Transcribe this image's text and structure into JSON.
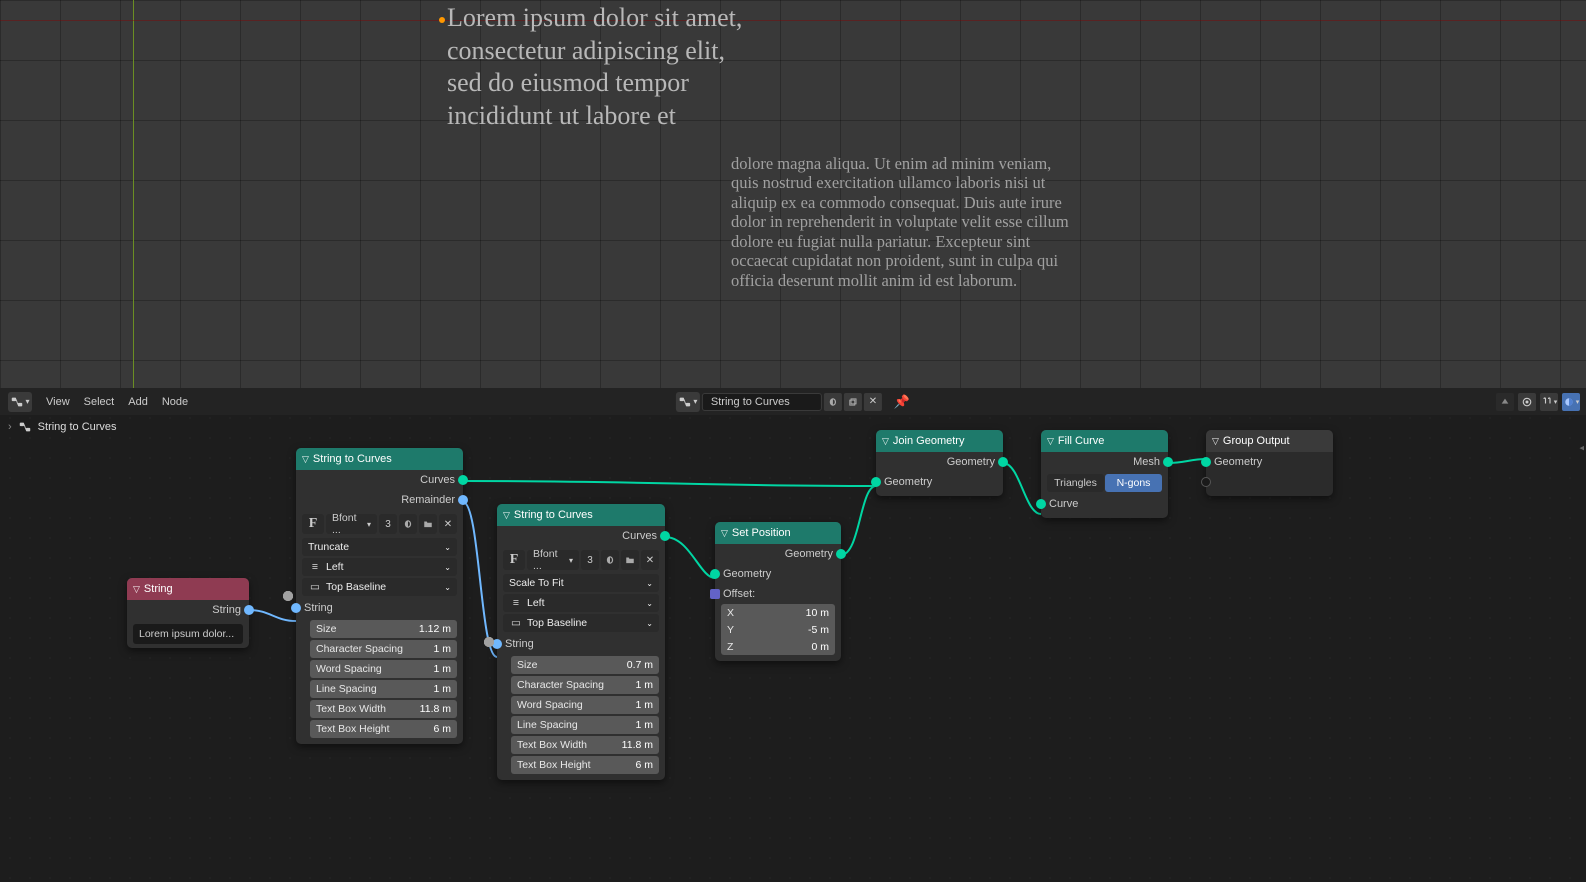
{
  "viewport": {
    "text1": "Lorem ipsum dolor sit amet, consectetur adipiscing elit, sed do eiusmod tempor incididunt ut labore et",
    "text2": "dolore magna aliqua. Ut enim ad minim veniam, quis nostrud exercitation ullamco laboris nisi ut aliquip ex ea commodo consequat. Duis aute irure dolor in reprehenderit in voluptate velit esse cillum dolore eu fugiat nulla pariatur. Excepteur sint occaecat cupidatat non proident, sunt in culpa qui officia deserunt mollit anim id est laborum."
  },
  "toolbar": {
    "menus": [
      "View",
      "Select",
      "Add",
      "Node"
    ],
    "nodegroup_name": "String to Curves",
    "breadcrumb": "String to Curves"
  },
  "nodes": {
    "string": {
      "title": "String",
      "out_label": "String",
      "value": "Lorem ipsum dolor..."
    },
    "stc1": {
      "title": "String to Curves",
      "out_curves": "Curves",
      "out_remainder": "Remainder",
      "in_string": "String",
      "font_name": "Bfont ...",
      "font_users": "3",
      "overflow": "Truncate",
      "align_x": "Left",
      "align_y": "Top Baseline",
      "props": [
        {
          "label": "Size",
          "value": "1.12 m"
        },
        {
          "label": "Character Spacing",
          "value": "1 m"
        },
        {
          "label": "Word Spacing",
          "value": "1 m"
        },
        {
          "label": "Line Spacing",
          "value": "1 m"
        },
        {
          "label": "Text Box Width",
          "value": "11.8 m"
        },
        {
          "label": "Text Box Height",
          "value": "6 m"
        }
      ]
    },
    "stc2": {
      "title": "String to Curves",
      "out_curves": "Curves",
      "in_string": "String",
      "font_name": "Bfont ...",
      "font_users": "3",
      "overflow": "Scale To Fit",
      "align_x": "Left",
      "align_y": "Top Baseline",
      "props": [
        {
          "label": "Size",
          "value": "0.7 m"
        },
        {
          "label": "Character Spacing",
          "value": "1 m"
        },
        {
          "label": "Word Spacing",
          "value": "1 m"
        },
        {
          "label": "Line Spacing",
          "value": "1 m"
        },
        {
          "label": "Text Box Width",
          "value": "11.8 m"
        },
        {
          "label": "Text Box Height",
          "value": "6 m"
        }
      ]
    },
    "setpos": {
      "title": "Set Position",
      "out_geometry": "Geometry",
      "in_geometry": "Geometry",
      "offset_label": "Offset:",
      "x_label": "X",
      "x_val": "10 m",
      "y_label": "Y",
      "y_val": "-5 m",
      "z_label": "Z",
      "z_val": "0 m"
    },
    "join": {
      "title": "Join Geometry",
      "out_geometry": "Geometry",
      "in_geometry": "Geometry"
    },
    "fill": {
      "title": "Fill Curve",
      "out_mesh": "Mesh",
      "in_curve": "Curve",
      "mode_tri": "Triangles",
      "mode_ngon": "N-gons"
    },
    "output": {
      "title": "Group Output",
      "in_geometry": "Geometry"
    }
  }
}
